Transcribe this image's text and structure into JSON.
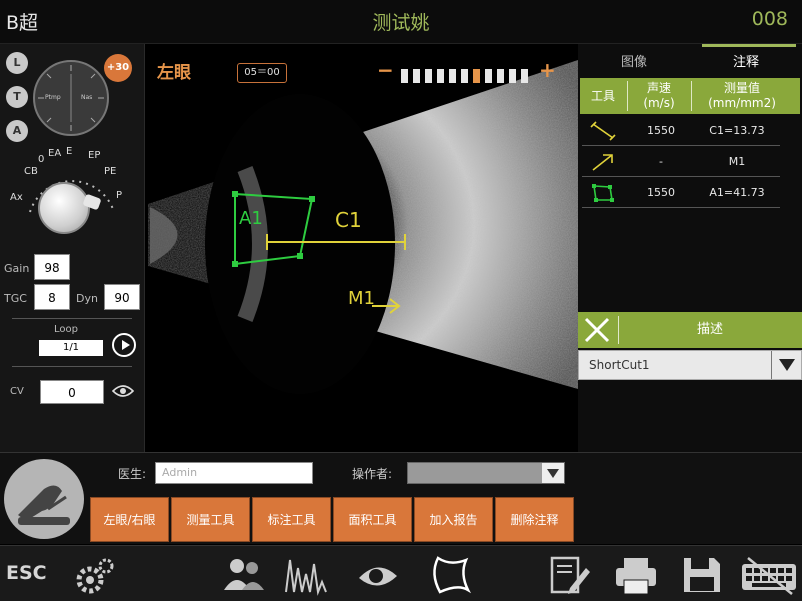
{
  "header": {
    "mode_title": "B超",
    "patient_name": "测试姚",
    "patient_id": "008"
  },
  "left_panel": {
    "mode_buttons": [
      "L",
      "T",
      "A"
    ],
    "angle_badge": "+30",
    "clock_labels": [
      "Ptmp",
      "Nas"
    ],
    "knob_labels": [
      "Ax",
      "CB",
      "0",
      "EA",
      "E",
      "EP",
      "PE",
      "P"
    ],
    "gain_label": "Gain",
    "gain_value": "98",
    "tgc_label": "TGC",
    "tgc_value": "8",
    "dyn_label": "Dyn",
    "dyn_value": "90",
    "loop_label": "Loop",
    "loop_value": "1/1",
    "cv_label": "CV",
    "cv_value": "0"
  },
  "image": {
    "eye_side": "左眼",
    "frame_counter": "05＝00",
    "gain_minus": "−",
    "gain_plus": "+",
    "gain_level": 0.55,
    "labels": {
      "a1": "A1",
      "c1": "C1",
      "m1": "M1"
    },
    "colors": {
      "area": "#2ecc40",
      "measure": "#e0d23a"
    }
  },
  "right_panel": {
    "tabs": [
      {
        "label": "图像"
      },
      {
        "label": "注释"
      }
    ],
    "table_headers": [
      "工具",
      "声速\n(m/s)",
      "测量值\n(mm/mm2)"
    ],
    "rows": [
      {
        "icon": "caliper-icon",
        "speed": "1550",
        "value": "C1=13.73"
      },
      {
        "icon": "arrow-icon",
        "speed": "-",
        "value": "M1"
      },
      {
        "icon": "area-icon",
        "speed": "1550",
        "value": "A1=41.73"
      }
    ],
    "description_label": "描述",
    "shortcut_value": "ShortCut1"
  },
  "lower": {
    "doctor_label": "医生:",
    "doctor_value": "Admin",
    "operator_label": "操作者:",
    "operator_value": "",
    "actions": [
      "左眼/右眼",
      "测量工具",
      "标注工具",
      "面积工具",
      "加入报告",
      "删除注释"
    ]
  },
  "toolbar": {
    "esc_label": "ESC"
  },
  "theme": {
    "accent": "#d9773a",
    "green": "#8aa83b",
    "title_green": "#9fb85a"
  }
}
